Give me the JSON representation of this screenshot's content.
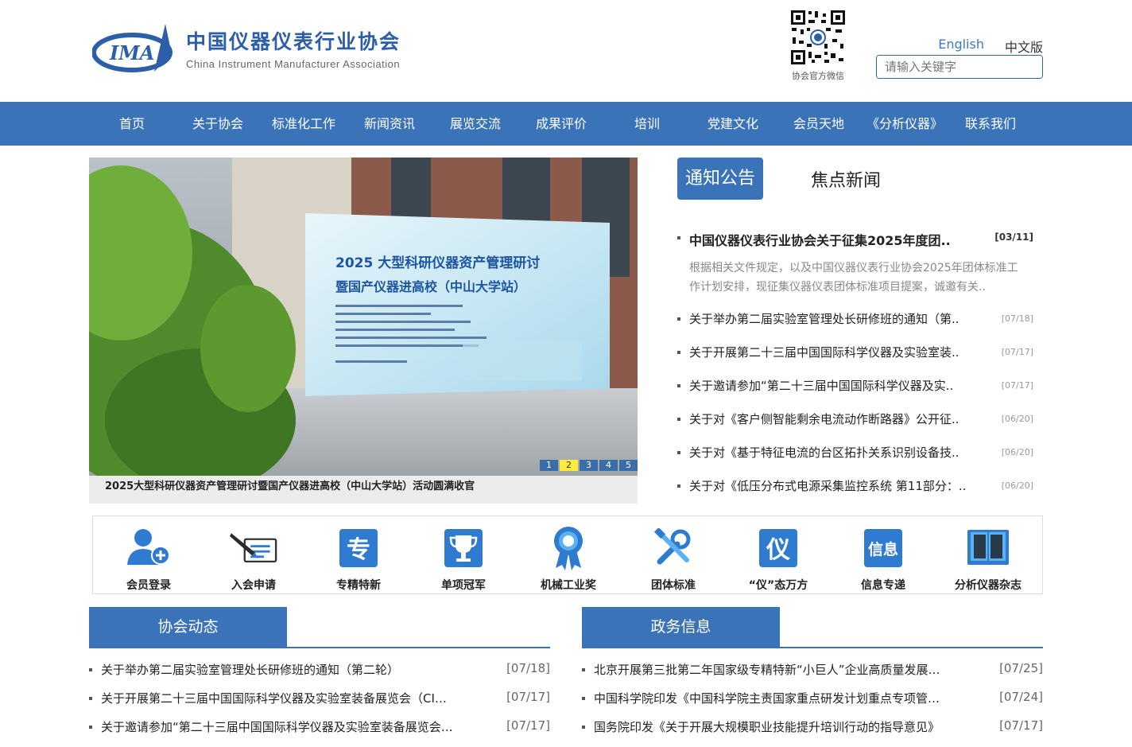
{
  "header": {
    "logo_cn": "中国仪器仪表行业协会",
    "logo_en": "China Instrument Manufacturer Association",
    "logo_mark": "IMA",
    "qr_caption": "协会官方微信",
    "lang_en": "English",
    "lang_cn": "中文版",
    "search_placeholder": "请输入关键字"
  },
  "nav": [
    "首页",
    "关于协会",
    "标准化工作",
    "新闻资讯",
    "展览交流",
    "成果评价",
    "培训",
    "党建文化",
    "会员天地",
    "《分析仪器》",
    "联系我们"
  ],
  "slider": {
    "caption": "2025大型科研仪器资产管理研讨暨国产仪器进高校（中山大学站）活动圆满收官",
    "board_title_1": "2025 大型科研仪器资产管理研讨",
    "board_title_2": "暨国产仪器进高校（中山大学站）",
    "pages": [
      "1",
      "2",
      "3",
      "4",
      "5"
    ],
    "active_page": 2
  },
  "news": {
    "tab_active": "通知公告",
    "tab_other": "焦点新闻",
    "top_title": "中国仪器仪表行业协会关于征集2025年度团..",
    "top_date": "[03/11]",
    "top_desc": "根据相关文件规定，以及中国仪器仪表行业协会2025年团体标准工作计划安排，现征集仪器仪表团体标准项目提案，诚邀有关..",
    "items": [
      {
        "title": "关于举办第二届实验室管理处长研修班的通知（第..",
        "date": "[07/18]"
      },
      {
        "title": "关于开展第二十三届中国国际科学仪器及实验室装..",
        "date": "[07/17]"
      },
      {
        "title": "关于邀请参加“第二十三届中国国际科学仪器及实..",
        "date": "[07/17]"
      },
      {
        "title": "关于对《客户侧智能剩余电流动作断路器》公开征..",
        "date": "[06/20]"
      },
      {
        "title": "关于对《基于特征电流的台区拓扑关系识别设备技..",
        "date": "[06/20]"
      },
      {
        "title": "关于对《低压分布式电源采集监控系统 第11部分：..",
        "date": "[06/20]"
      }
    ]
  },
  "quick_links": [
    {
      "label": "会员登录",
      "icon": "member-login-icon"
    },
    {
      "label": "入会申请",
      "icon": "apply-icon"
    },
    {
      "label": "专精特新",
      "icon": "zhuan-icon",
      "glyph": "专"
    },
    {
      "label": "单项冠军",
      "icon": "trophy-icon"
    },
    {
      "label": "机械工业奖",
      "icon": "award-icon"
    },
    {
      "label": "团体标准",
      "icon": "tools-icon"
    },
    {
      "label": "“仪”态万方",
      "icon": "yi-icon",
      "glyph": "仪"
    },
    {
      "label": "信息专递",
      "icon": "xin-icon",
      "glyph": "信息"
    },
    {
      "label": "分析仪器杂志",
      "icon": "book-icon"
    }
  ],
  "association": {
    "title": "协会动态",
    "items": [
      {
        "title": "关于举办第二届实验室管理处长研修班的通知（第二轮）",
        "date": "[07/18]"
      },
      {
        "title": "关于开展第二十三届中国国际科学仪器及实验室装备展览会（CI…",
        "date": "[07/17]"
      },
      {
        "title": "关于邀请参加“第二十三届中国国际科学仪器及实验室装备展览会…",
        "date": "[07/17]"
      }
    ]
  },
  "government": {
    "title": "政务信息",
    "items": [
      {
        "title": "北京开展第三批第二年国家级专精特新“小巨人”企业高质量发展…",
        "date": "[07/25]"
      },
      {
        "title": "中国科学院印发《中国科学院主责国家重点研发计划重点专项管…",
        "date": "[07/24]"
      },
      {
        "title": "国务院印发《关于开展大规模职业技能提升培训行动的指导意见》",
        "date": "[07/17]"
      }
    ]
  },
  "colors": {
    "brand": "#3b73b9",
    "accent_yellow": "#ffeb3b"
  }
}
